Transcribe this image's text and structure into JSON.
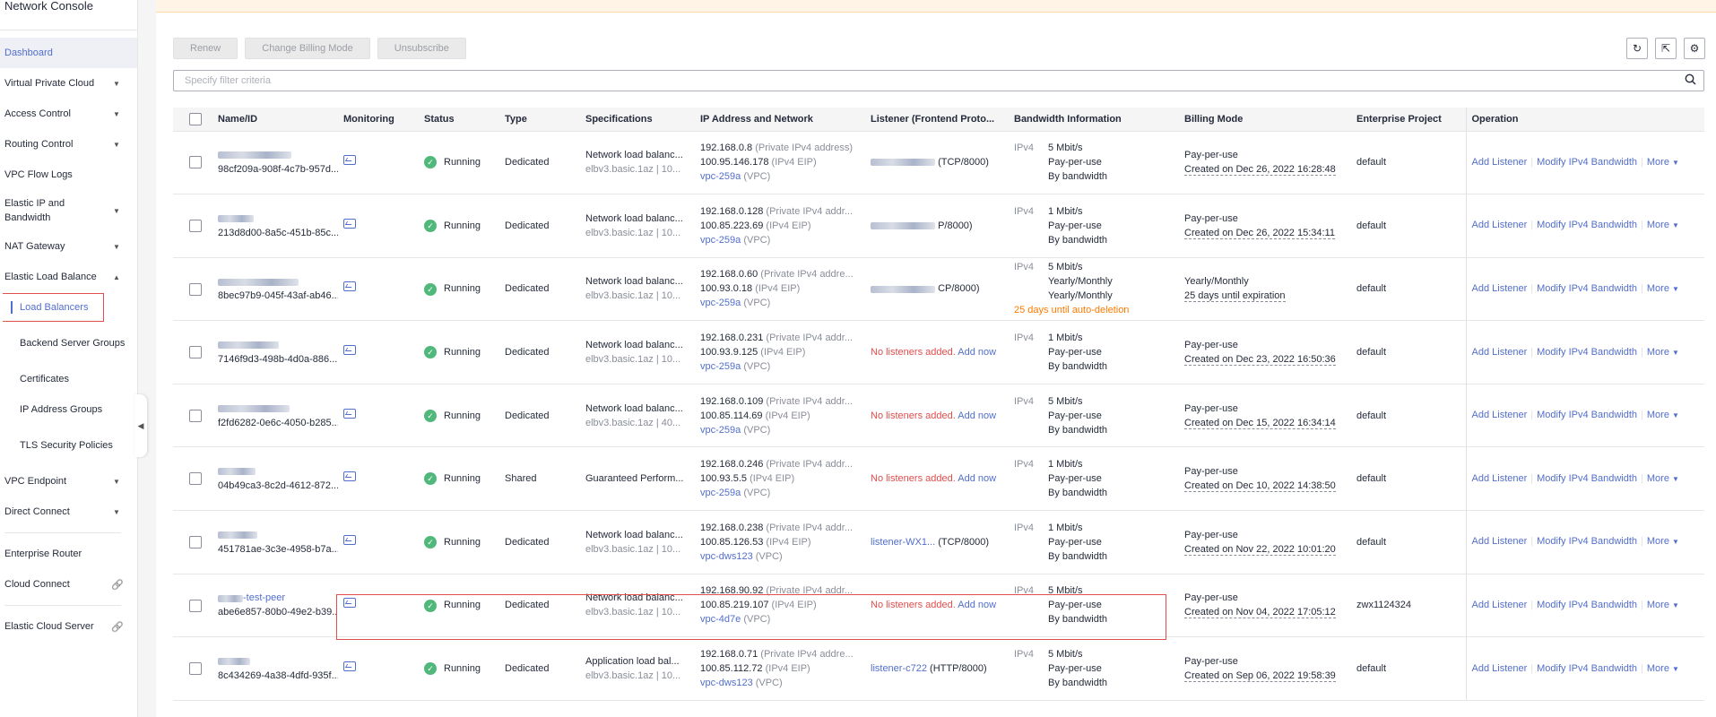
{
  "sidebar": {
    "title": "Network Console",
    "items": [
      {
        "label": "Dashboard",
        "chevron": ""
      },
      {
        "label": "Virtual Private Cloud",
        "chevron": "down"
      },
      {
        "label": "Access Control",
        "chevron": "down"
      },
      {
        "label": "Routing Control",
        "chevron": "down"
      },
      {
        "label": "VPC Flow Logs",
        "chevron": ""
      },
      {
        "label": "Elastic IP and Bandwidth",
        "chevron": "down"
      },
      {
        "label": "NAT Gateway",
        "chevron": "down"
      },
      {
        "label": "Elastic Load Balance",
        "chevron": "up"
      }
    ],
    "sub_items": [
      {
        "label": "Load Balancers"
      },
      {
        "label": "Backend Server Groups"
      },
      {
        "label": "Certificates"
      },
      {
        "label": "IP Address Groups"
      },
      {
        "label": "TLS Security Policies"
      }
    ],
    "items_after": [
      {
        "label": "VPC Endpoint"
      },
      {
        "label": "Direct Connect"
      },
      {
        "label": "Enterprise Router"
      },
      {
        "label": "Cloud Connect"
      },
      {
        "label": "Elastic Cloud Server"
      }
    ]
  },
  "toolbar": {
    "renew": "Renew",
    "change_billing": "Change Billing Mode",
    "unsubscribe": "Unsubscribe"
  },
  "filter": {
    "placeholder": "Specify filter criteria"
  },
  "columns": [
    "Name/ID",
    "Monitoring",
    "Status",
    "Type",
    "Specifications",
    "IP Address and Network",
    "Listener (Frontend Proto...",
    "Bandwidth Information",
    "Billing Mode",
    "Enterprise Project",
    "Operation"
  ],
  "op_labels": {
    "add_listener": "Add Listener",
    "modify_bw": "Modify IPv4 Bandwidth",
    "more": "More"
  },
  "rows": [
    {
      "name": "",
      "id": "98cf209a-908f-4c7b-957d...",
      "status": "Running",
      "type": "Dedicated",
      "spec1": "Network load balanc...",
      "spec2": "elbv3.basic.1az | 10...",
      "ip1": "192.168.0.8",
      "ip1_note": "(Private IPv4 address)",
      "ip2": "100.95.146.178",
      "ip2_note": "(IPv4 EIP)",
      "vpc": "vpc-259a",
      "vpc_note": "(VPC)",
      "listener_type": "blur",
      "listener_text": "(TCP/8000)",
      "bw_kind": "IPv4",
      "bw1": "5 Mbit/s",
      "bw2": "Pay-per-use",
      "bw3": "By bandwidth",
      "bw4": "",
      "bill1": "Pay-per-use",
      "bill2": "Created on Dec 26, 2022 16:28:48",
      "project": "default"
    },
    {
      "name": "",
      "id": "213d8d00-8a5c-451b-85c...",
      "status": "Running",
      "type": "Dedicated",
      "spec1": "Network load balanc...",
      "spec2": "elbv3.basic.1az | 10...",
      "ip1": "192.168.0.128",
      "ip1_note": "(Private IPv4 addr...",
      "ip2": "100.85.223.69",
      "ip2_note": "(IPv4 EIP)",
      "vpc": "vpc-259a",
      "vpc_note": "(VPC)",
      "listener_type": "blur",
      "listener_text": "P/8000)",
      "bw_kind": "IPv4",
      "bw1": "1 Mbit/s",
      "bw2": "Pay-per-use",
      "bw3": "By bandwidth",
      "bw4": "",
      "bill1": "Pay-per-use",
      "bill2": "Created on Dec 26, 2022 15:34:11",
      "project": "default"
    },
    {
      "name": "",
      "id": "8bec97b9-045f-43af-ab46...",
      "status": "Running",
      "type": "Dedicated",
      "spec1": "Network load balanc...",
      "spec2": "elbv3.basic.1az | 10...",
      "ip1": "192.168.0.60",
      "ip1_note": "(Private IPv4 addre...",
      "ip2": "100.93.0.18",
      "ip2_note": "(IPv4 EIP)",
      "vpc": "vpc-259a",
      "vpc_note": "(VPC)",
      "listener_type": "blur",
      "listener_text": "CP/8000)",
      "bw_kind": "IPv4",
      "bw1": "5 Mbit/s",
      "bw2": "Yearly/Monthly",
      "bw3": "Yearly/Monthly",
      "bw4": "25 days until auto-deletion",
      "bill1": "Yearly/Monthly",
      "bill2": "25 days until expiration",
      "project": "default"
    },
    {
      "name": "",
      "id": "7146f9d3-498b-4d0a-886...",
      "status": "Running",
      "type": "Dedicated",
      "spec1": "Network load balanc...",
      "spec2": "elbv3.basic.1az | 10...",
      "ip1": "192.168.0.231",
      "ip1_note": "(Private IPv4 addr...",
      "ip2": "100.93.9.125",
      "ip2_note": "(IPv4 EIP)",
      "vpc": "vpc-259a",
      "vpc_note": "(VPC)",
      "listener_type": "none",
      "listener_text": "No listeners added.",
      "listener_link": "Add now",
      "bw_kind": "IPv4",
      "bw1": "1 Mbit/s",
      "bw2": "Pay-per-use",
      "bw3": "By bandwidth",
      "bw4": "",
      "bill1": "Pay-per-use",
      "bill2": "Created on Dec 23, 2022 16:50:36",
      "project": "default"
    },
    {
      "name": "",
      "id": "f2fd6282-0e6c-4050-b285...",
      "status": "Running",
      "type": "Dedicated",
      "spec1": "Network load balanc...",
      "spec2": "elbv3.basic.1az | 40...",
      "ip1": "192.168.0.109",
      "ip1_note": "(Private IPv4 addr...",
      "ip2": "100.85.114.69",
      "ip2_note": "(IPv4 EIP)",
      "vpc": "vpc-259a",
      "vpc_note": "(VPC)",
      "listener_type": "none",
      "listener_text": "No listeners added.",
      "listener_link": "Add now",
      "bw_kind": "IPv4",
      "bw1": "5 Mbit/s",
      "bw2": "Pay-per-use",
      "bw3": "By bandwidth",
      "bw4": "",
      "bill1": "Pay-per-use",
      "bill2": "Created on Dec 15, 2022 16:34:14",
      "project": "default"
    },
    {
      "name": "",
      "id": "04b49ca3-8c2d-4612-872...",
      "status": "Running",
      "type": "Shared",
      "spec1": "Guaranteed Perform...",
      "spec2": "",
      "ip1": "192.168.0.246",
      "ip1_note": "(Private IPv4 addr...",
      "ip2": "100.93.5.5",
      "ip2_note": "(IPv4 EIP)",
      "vpc": "vpc-259a",
      "vpc_note": "(VPC)",
      "listener_type": "none",
      "listener_text": "No listeners added.",
      "listener_link": "Add now",
      "bw_kind": "IPv4",
      "bw1": "1 Mbit/s",
      "bw2": "Pay-per-use",
      "bw3": "By bandwidth",
      "bw4": "",
      "bill1": "Pay-per-use",
      "bill2": "Created on Dec 10, 2022 14:38:50",
      "project": "default"
    },
    {
      "name": "",
      "id": "451781ae-3c3e-4958-b7a...",
      "status": "Running",
      "type": "Dedicated",
      "spec1": "Network load balanc...",
      "spec2": "elbv3.basic.1az | 10...",
      "ip1": "192.168.0.238",
      "ip1_note": "(Private IPv4 addr...",
      "ip2": "100.85.126.53",
      "ip2_note": "(IPv4 EIP)",
      "vpc": "vpc-dws123",
      "vpc_note": "(VPC)",
      "listener_type": "link",
      "listener_link": "listener-WX1...",
      "listener_text": "(TCP/8000)",
      "bw_kind": "IPv4",
      "bw1": "1 Mbit/s",
      "bw2": "Pay-per-use",
      "bw3": "By bandwidth",
      "bw4": "",
      "bill1": "Pay-per-use",
      "bill2": "Created on Nov 22, 2022 10:01:20",
      "project": "default"
    },
    {
      "name": "-test-peer",
      "id": "abe6e857-80b0-49e2-b39...",
      "status": "Running",
      "type": "Dedicated",
      "spec1": "Network load balanc...",
      "spec2": "elbv3.basic.1az | 10...",
      "ip1": "192.168.90.92",
      "ip1_note": "(Private IPv4 addr...",
      "ip2": "100.85.219.107",
      "ip2_note": "(IPv4 EIP)",
      "vpc": "vpc-4d7e",
      "vpc_note": "(VPC)",
      "listener_type": "none",
      "listener_text": "No listeners added.",
      "listener_link": "Add now",
      "bw_kind": "IPv4",
      "bw1": "5 Mbit/s",
      "bw2": "Pay-per-use",
      "bw3": "By bandwidth",
      "bw4": "",
      "bill1": "Pay-per-use",
      "bill2": "Created on Nov 04, 2022 17:05:12",
      "project": "zwx1124324"
    },
    {
      "name": "",
      "id": "8c434269-4a38-4dfd-935f...",
      "status": "Running",
      "type": "Dedicated",
      "spec1": "Application load bal...",
      "spec2": "elbv3.basic.1az | 10...",
      "ip1": "192.168.0.71",
      "ip1_note": "(Private IPv4 addre...",
      "ip2": "100.85.112.72",
      "ip2_note": "(IPv4 EIP)",
      "vpc": "vpc-dws123",
      "vpc_note": "(VPC)",
      "listener_type": "link",
      "listener_link": "listener-c722",
      "listener_text": "(HTTP/8000)",
      "bw_kind": "IPv4",
      "bw1": "5 Mbit/s",
      "bw2": "Pay-per-use",
      "bw3": "By bandwidth",
      "bw4": "",
      "bill1": "Pay-per-use",
      "bill2": "Created on Sep 06, 2022 19:58:39",
      "project": "default"
    }
  ]
}
